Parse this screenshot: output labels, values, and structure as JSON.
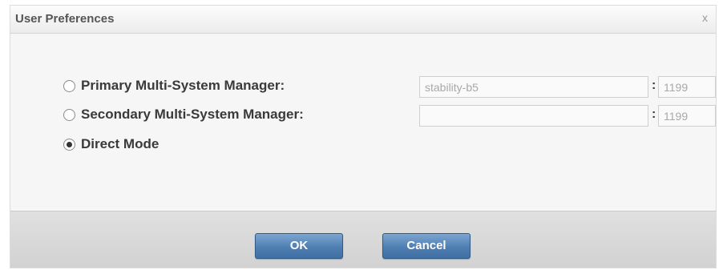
{
  "dialog": {
    "title": "User Preferences",
    "close_label": "x"
  },
  "options": [
    {
      "label": "Primary Multi-System Manager:",
      "selected": false,
      "host_value": "stability-b5",
      "port_value": "1199"
    },
    {
      "label": "Secondary Multi-System Manager:",
      "selected": false,
      "host_value": "",
      "port_value": "1199"
    },
    {
      "label": "Direct Mode",
      "selected": true
    }
  ],
  "separator": ":",
  "buttons": {
    "ok_label": "OK",
    "cancel_label": "Cancel"
  },
  "figure_id": "iv10565",
  "colors": {
    "button_blue": "#4f7fb2",
    "footer_gray": "#d6d6d6",
    "label_text": "#3a3a3a"
  }
}
